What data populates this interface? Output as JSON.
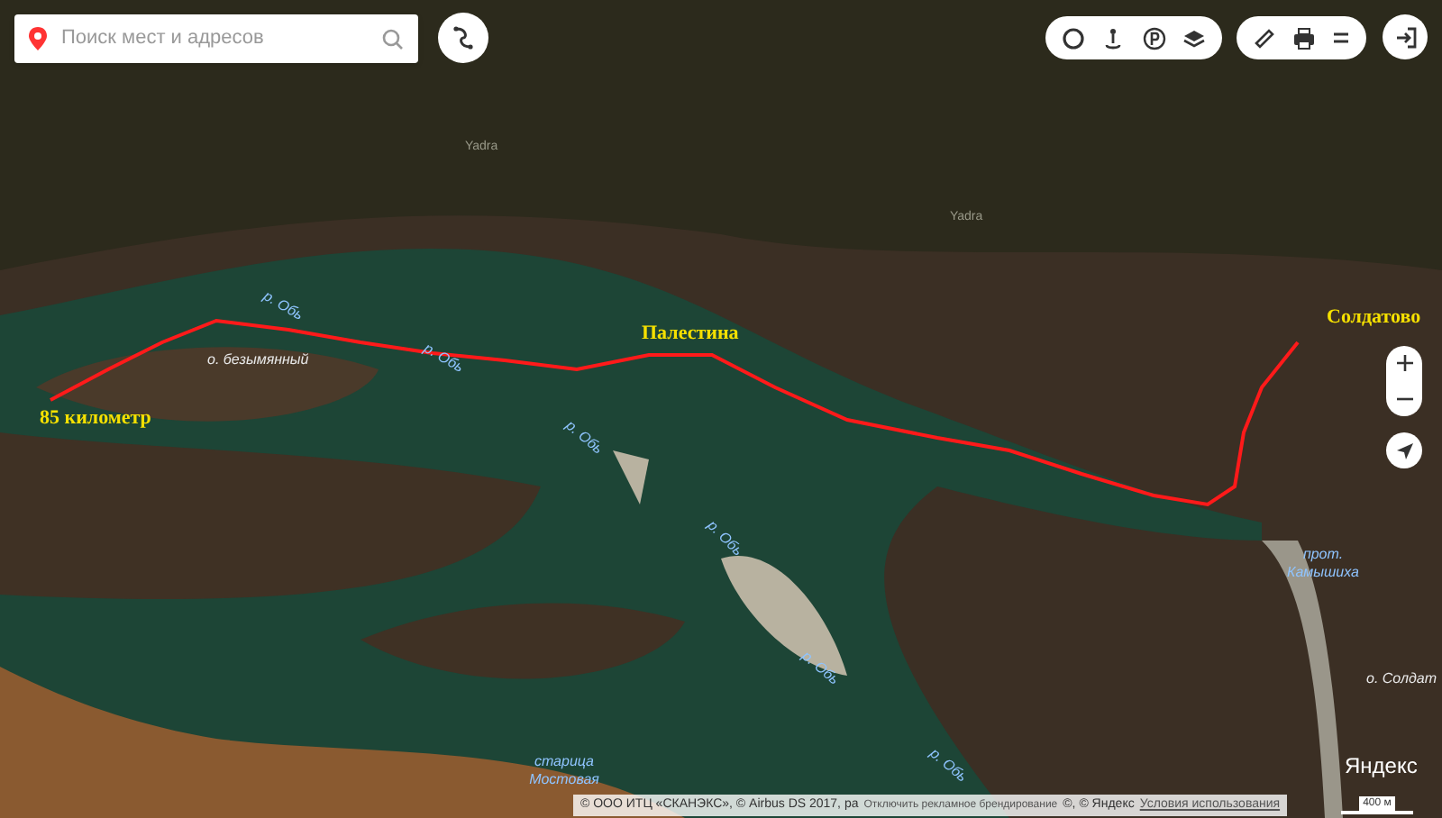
{
  "search": {
    "placeholder": "Поиск мест и адресов"
  },
  "map_labels": [
    {
      "kind": "faint",
      "text": "Yadra"
    },
    {
      "kind": "faint",
      "text": "Yadra"
    },
    {
      "kind": "water",
      "text": "р. Обь"
    },
    {
      "kind": "island",
      "text": "о. безымянный"
    },
    {
      "kind": "water",
      "text": "р. Обь"
    },
    {
      "kind": "place",
      "text": "Палестина"
    },
    {
      "kind": "place",
      "text": "Солдатово"
    },
    {
      "kind": "place",
      "text": "85 километр"
    },
    {
      "kind": "water",
      "text": "р. Обь"
    },
    {
      "kind": "water",
      "text": "р. Обь"
    },
    {
      "kind": "water",
      "text": "прот. Камышиха"
    },
    {
      "kind": "water",
      "text": "р. Обь"
    },
    {
      "kind": "island",
      "text": "о. Солдат"
    },
    {
      "kind": "water",
      "text": "р. Обь"
    },
    {
      "kind": "water",
      "text": "старица Мостовая"
    }
  ],
  "logo": "Яндекс",
  "attribution": {
    "text": "© ООО ИТЦ «СКАНЭКС», © Airbus DS 2017, ра",
    "overlay_link": "Отключить рекламное брендирование",
    "rest": "©, © Яндекс",
    "terms_link": "Условия использования"
  },
  "scale": "400 м"
}
